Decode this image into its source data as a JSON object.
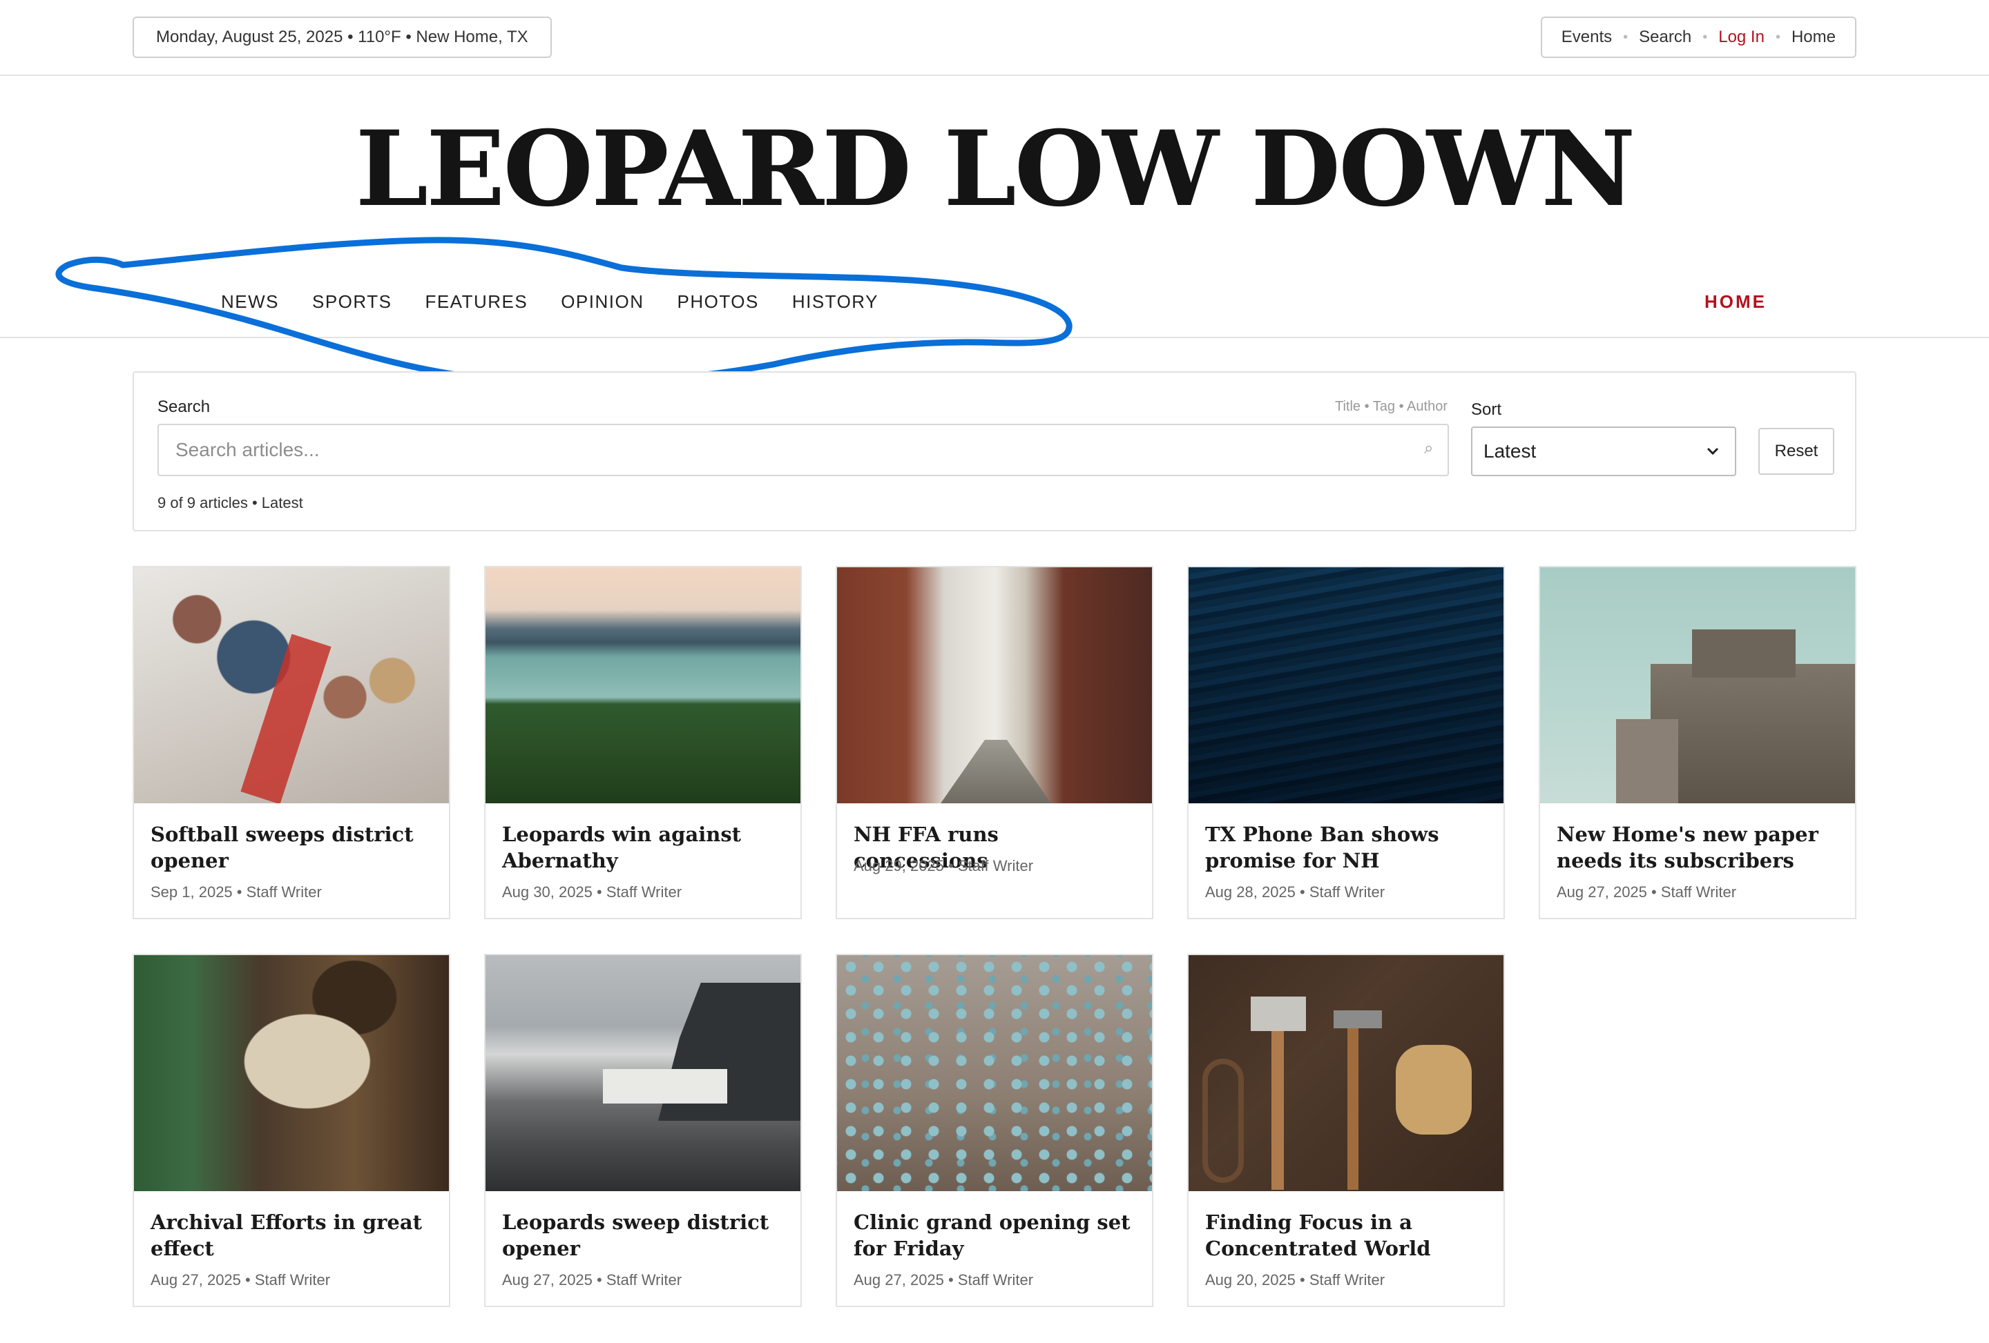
{
  "topbar": {
    "date_weather": "Monday, August 25, 2025 • 110°F • New Home, TX",
    "links": [
      "Events",
      "Search",
      "Log In",
      "Home"
    ]
  },
  "masthead": {
    "title": "LEOPARD LOW DOWN"
  },
  "nav": {
    "items": [
      "NEWS",
      "SPORTS",
      "FEATURES",
      "OPINION",
      "PHOTOS",
      "HISTORY"
    ],
    "home": "HOME"
  },
  "search": {
    "label": "Search",
    "hint": "Title • Tag • Author",
    "placeholder": "Search articles...",
    "value": "",
    "sort_label": "Sort",
    "sort_value": "Latest",
    "reset_label": "Reset",
    "count": "9 of 9 articles • Latest"
  },
  "articles": [
    {
      "title": "Softball sweeps district opener",
      "meta": "Sep 1, 2025 • Staff Writer",
      "image": "padlocks-on-fence"
    },
    {
      "title": "Leopards win against Abernathy",
      "meta": "Aug 30, 2025 • Staff Writer",
      "image": "lake-and-forest"
    },
    {
      "title": "NH FFA runs concessions",
      "meta": "Aug 29, 2025 • Staff Writer",
      "image": "brick-alley"
    },
    {
      "title": "TX Phone Ban shows promise for NH",
      "meta": "Aug 28, 2025 • Staff Writer",
      "image": "water-surface"
    },
    {
      "title": "New Home's new paper needs its subscribers",
      "meta": "Aug 27, 2025 • Staff Writer",
      "image": "concrete-bunker"
    },
    {
      "title": "Archival Efforts in great effect",
      "meta": "Aug 27, 2025 • Staff Writer",
      "image": "man-sleeping-on-train"
    },
    {
      "title": "Leopards sweep district opener",
      "meta": "Aug 27, 2025 • Staff Writer",
      "image": "coastal-cliff-houses"
    },
    {
      "title": "Clinic grand opening set for Friday",
      "meta": "Aug 27, 2025 • Staff Writer",
      "image": "water-droplets"
    },
    {
      "title": "Finding Focus in a Concentrated World",
      "meta": "Aug 20, 2025 • Staff Writer",
      "image": "tools-on-wood"
    }
  ],
  "colors": {
    "accent_red": "#b3121d",
    "annotation_blue": "#0a6fd8"
  }
}
